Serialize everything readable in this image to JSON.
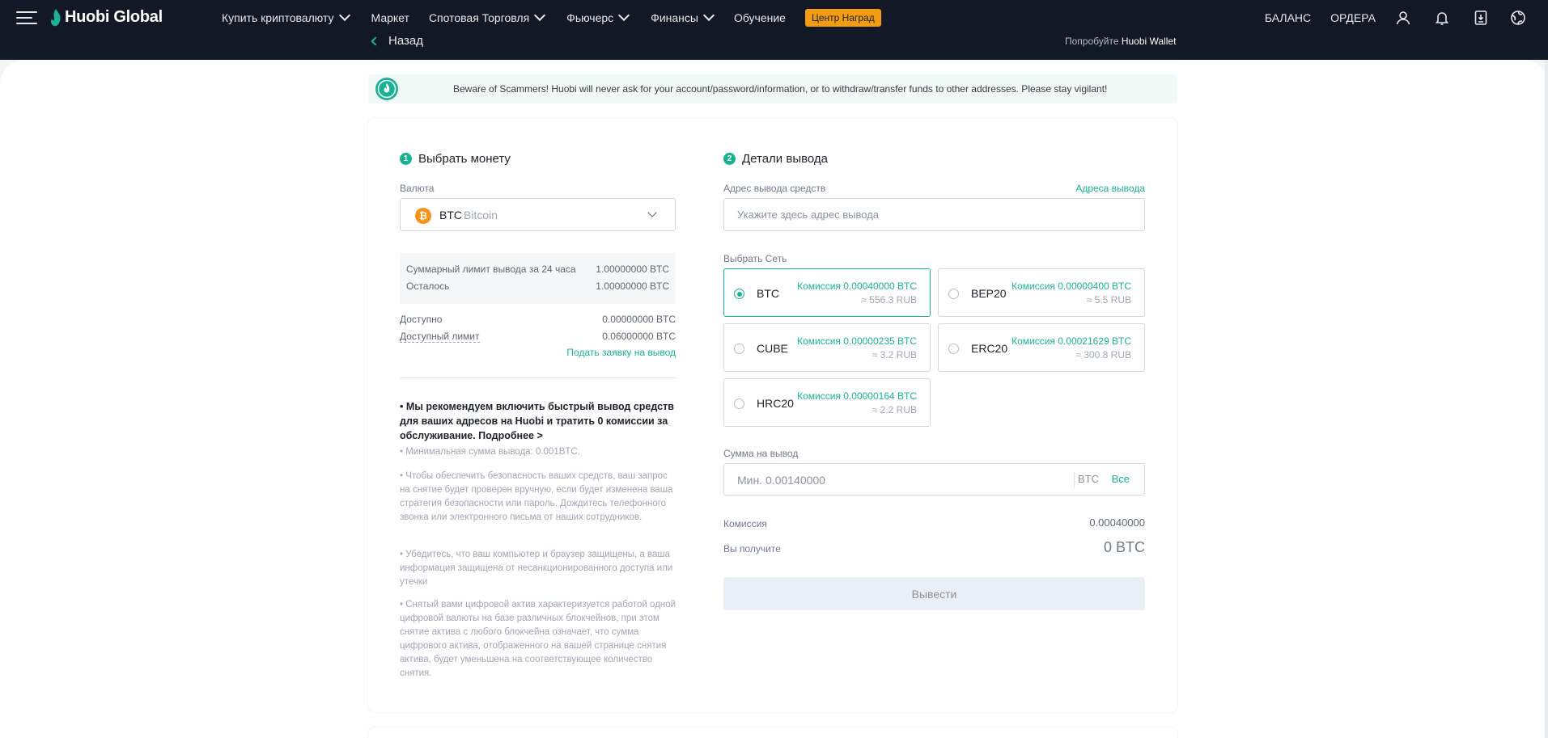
{
  "header": {
    "logo": "Huobi Global",
    "nav": [
      {
        "label": "Купить криптовалюту",
        "dropdown": true
      },
      {
        "label": "Маркет",
        "dropdown": false
      },
      {
        "label": "Спотовая Торговля",
        "dropdown": true
      },
      {
        "label": "Фьючерс",
        "dropdown": true
      },
      {
        "label": "Финансы",
        "dropdown": true
      },
      {
        "label": "Обучение",
        "dropdown": false
      }
    ],
    "rewards_badge": "Центр Наград",
    "balance_link": "БАЛАНС",
    "orders_link": "ОРДЕРА",
    "icons": [
      "user-icon",
      "bell-icon",
      "download-icon",
      "globe-icon"
    ],
    "back_label": "Назад",
    "wallet_prefix": "Попробуйте",
    "wallet_name": "Huobi Wallet"
  },
  "warning": "Beware of Scammers! Huobi will never ask for your account/password/information, or to withdraw/transfer funds to other addresses. Please stay vigilant!",
  "left": {
    "step_num": "1",
    "title": "Выбрать монету",
    "currency_label": "Валюта",
    "coin_symbol": "BTC",
    "coin_name": "Bitcoin",
    "limit_24h_label": "Суммарный лимит вывода за 24 часа",
    "limit_24h_value": "1.00000000 BTC",
    "remaining_label": "Осталось",
    "remaining_value": "1.00000000 BTC",
    "available_label": "Доступно",
    "available_value": "0.00000000 BTC",
    "available_limit_label": "Доступный лимит",
    "available_limit_value": "0.06000000 BTC",
    "apply_link": "Подать заявку на вывод",
    "tip_strong": "• Мы рекомендуем включить быстрый вывод средств для ваших адресов на Huobi и тратить 0 комиссии за обслуживание. Подробнее >",
    "tips": [
      "• Минимальная сумма вывода: 0.001BTC.",
      "• Чтобы обеспечить безопасность ваших средств, ваш запрос на снятие будет проверен вручную, если будет изменена ваша стратегия безопасности или пароль. Дождитесь телефонного звонка или электронного письма от наших сотрудников.",
      "• Убедитесь, что ваш компьютер и браузер защищены, а ваша информация защищена от несанкционированного доступа или утечки",
      "• Снятый вами цифровой актив характеризуется работой одной цифровой валюты на базе различных блокчейнов, при этом снятие актива с любого блокчейна означает, что сумма цифрового актива, отображенного на вашей странице снятия актива, будет уменьшена на соответствующее количество снятия."
    ]
  },
  "right": {
    "step_num": "2",
    "title": "Детали вывода",
    "address_label": "Адрес вывода средств",
    "address_link": "Адреса вывода",
    "address_placeholder": "Укажите здесь адрес вывода",
    "network_label": "Выбрать Сеть",
    "networks": [
      {
        "name": "BTC",
        "fee": "Комиссия 0.00040000 BTC",
        "rub": "≈ 556.3 RUB",
        "selected": true
      },
      {
        "name": "BEP20",
        "fee": "Комиссия 0.00000400 BTC",
        "rub": "≈ 5.5 RUB",
        "selected": false
      },
      {
        "name": "CUBE",
        "fee": "Комиссия 0.00000235 BTC",
        "rub": "≈ 3.2 RUB",
        "selected": false
      },
      {
        "name": "ERC20",
        "fee": "Комиссия 0.00021629 BTC",
        "rub": "≈ 300.8 RUB",
        "selected": false
      },
      {
        "name": "HRC20",
        "fee": "Комиссия 0.00000164 BTC",
        "rub": "≈ 2.2 RUB",
        "selected": false
      }
    ],
    "amount_label": "Сумма на вывод",
    "amount_placeholder": "Мин. 0.00140000",
    "amount_unit": "BTC",
    "amount_all": "Все",
    "fee_label": "Комиссия",
    "fee_value": "0.00040000",
    "receive_label": "Вы получите",
    "receive_value": "0 BTC",
    "submit_label": "Вывести"
  },
  "colors": {
    "accent": "#19b393",
    "header_bg": "#121826",
    "badge": "#f39c12"
  }
}
